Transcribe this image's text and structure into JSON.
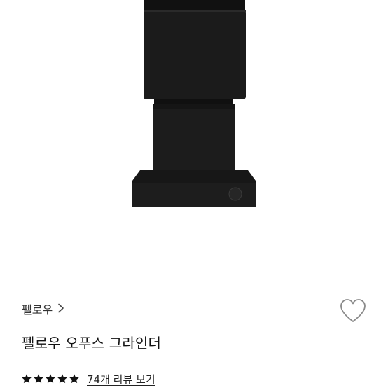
{
  "product": {
    "brand": "펠로우",
    "title": "펠로우 오푸스 그라인더",
    "rating_value": 5,
    "rating_max": 5,
    "review_link": "74개 리뷰 보기"
  },
  "icons": {
    "brand_chevron": "chevron-right-icon",
    "wishlist": "heart-outline-icon",
    "star": "star-filled-icon"
  },
  "colors": {
    "product": "#1b1b1b",
    "text": "#111111",
    "icon_outline": "#8a8a8a"
  }
}
